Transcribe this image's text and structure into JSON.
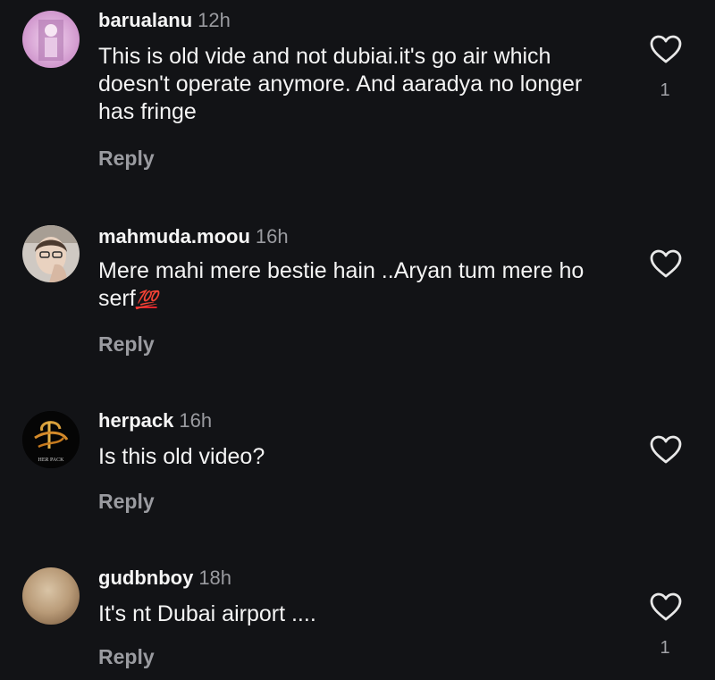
{
  "comments": [
    {
      "username": "barualanu",
      "time": "12h",
      "text": "This is old vide and not dubiai.it's go air which doesn't operate anymore. And aaradya no longer has fringe",
      "reply_label": "Reply",
      "like_count": "1",
      "avatar_icon": "user-avatar-icon"
    },
    {
      "username": "mahmuda.moou",
      "time": "16h",
      "text": "Mere mahi mere bestie hain ..Aryan tum mere ho serf",
      "emoji": "💯",
      "reply_label": "Reply",
      "avatar_icon": "user-avatar-icon"
    },
    {
      "username": "herpack",
      "time": "16h",
      "text": "Is this old video?",
      "reply_label": "Reply",
      "avatar_text": "HER PACK",
      "avatar_icon": "brand-logo-avatar-icon"
    },
    {
      "username": "gudbnboy",
      "time": "18h",
      "text": "It's nt Dubai airport ....",
      "reply_label": "Reply",
      "like_count": "1",
      "avatar_icon": "user-avatar-icon"
    }
  ],
  "colors": {
    "background": "#121316",
    "primary_text": "#f4f4f4",
    "secondary_text": "#9a9ba0",
    "emoji_red": "#e0242c"
  }
}
